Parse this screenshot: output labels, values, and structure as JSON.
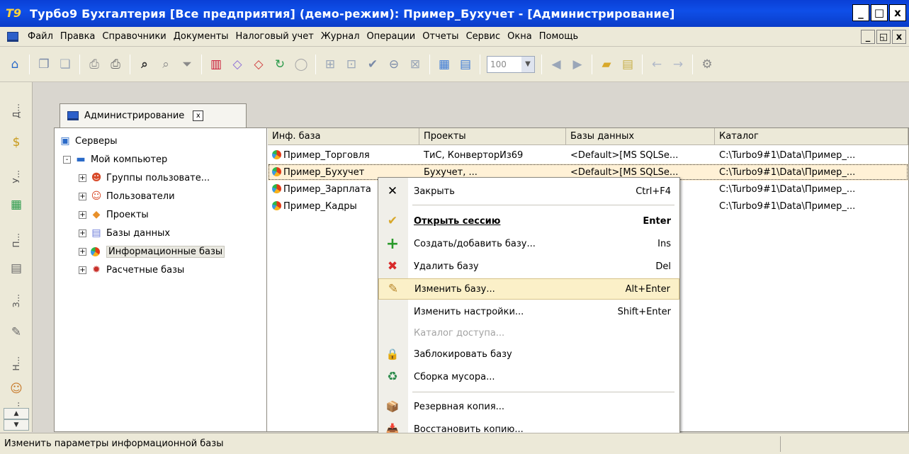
{
  "window": {
    "title": "Турбо9 Бухгалтерия [Все предприятия] (демо-режим): Пример_Бухучет - [Администрирование]",
    "app_icon": "Т9",
    "buttons": [
      "_",
      "□",
      "x"
    ]
  },
  "menubar": {
    "items": [
      "Файл",
      "Правка",
      "Справочники",
      "Документы",
      "Налоговый учет",
      "Журнал",
      "Операции",
      "Отчеты",
      "Сервис",
      "Окна",
      "Помощь"
    ],
    "mdi_buttons": [
      "_",
      "◱",
      "x"
    ]
  },
  "toolbar": {
    "zoom_value": "100",
    "icons": [
      "home-icon",
      "copy-icon",
      "paste-icon",
      "print-preview-icon",
      "print-icon",
      "search-icon",
      "find-next-icon",
      "filter-icon",
      "chart-icon",
      "eraser-icon",
      "pencil-icon",
      "refresh-icon",
      "stop-icon",
      "add-row-icon",
      "add-doc-icon",
      "check-icon",
      "minus-icon",
      "delete-icon",
      "calculator-icon",
      "calendar-icon",
      "back-icon",
      "forward-icon",
      "folder-icon",
      "notes-icon",
      "undo-icon",
      "redo-icon"
    ]
  },
  "sidebar": {
    "labels": [
      "Д...",
      "У...",
      "П...",
      "З...",
      "Н...",
      "О..."
    ]
  },
  "doc_tab": {
    "label": "Администрирование",
    "close": "x"
  },
  "tree": {
    "root": "Серверы",
    "computer": "Мой компьютер",
    "nodes": [
      "Группы пользовате...",
      "Пользователи",
      "Проекты",
      "Базы данных",
      "Информационные базы",
      "Расчетные базы"
    ],
    "expanders": [
      "+",
      "-"
    ]
  },
  "grid": {
    "columns": [
      "Инф. база",
      "Проекты",
      "Базы данных",
      "Каталог"
    ],
    "rows": [
      {
        "name": "Пример_Торговля",
        "projects": "ТиС, КонверторИз69",
        "db": "<Default>[MS SQLSe...",
        "catalog": "C:\\Turbo9#1\\Data\\Пример_..."
      },
      {
        "name": "Пример_Бухучет",
        "projects": "Бухучет, ...",
        "db": "<Default>[MS SQLSe...",
        "catalog": "C:\\Turbo9#1\\Data\\Пример_..."
      },
      {
        "name": "Пример_Зарплата",
        "projects": "",
        "db": "<Default>[MS SQLSe...",
        "catalog": "C:\\Turbo9#1\\Data\\Пример_..."
      },
      {
        "name": "Пример_Кадры",
        "projects": "",
        "db": "<Default>[MS SQLSe...",
        "catalog": "C:\\Turbo9#1\\Data\\Пример_..."
      }
    ]
  },
  "context_menu": {
    "items": [
      {
        "label": "Закрыть",
        "shortcut": "Ctrl+F4",
        "icon": "✕"
      },
      {
        "label": "Открыть сессию",
        "shortcut": "Enter",
        "icon": "✔"
      },
      {
        "label": "Создать/добавить базу...",
        "shortcut": "Ins",
        "icon": "+"
      },
      {
        "label": "Удалить базу",
        "shortcut": "Del",
        "icon": "✖"
      },
      {
        "label": "Изменить базу...",
        "shortcut": "Alt+Enter",
        "icon": "✎"
      },
      {
        "label": "Изменить настройки...",
        "shortcut": "Shift+Enter",
        "icon": ""
      },
      {
        "label": "Каталог доступа...",
        "shortcut": "",
        "icon": ""
      },
      {
        "label": "Заблокировать базу",
        "shortcut": "",
        "icon": "🔒"
      },
      {
        "label": "Сборка мусора...",
        "shortcut": "",
        "icon": "♻"
      },
      {
        "label": "Резервная копия...",
        "shortcut": "",
        "icon": "📦"
      },
      {
        "label": "Восстановить копию...",
        "shortcut": "",
        "icon": "📥"
      }
    ]
  },
  "statusbar": {
    "text": "Изменить параметры информационной базы"
  },
  "colors": {
    "titlebar": "#0f4fe8",
    "menu_highlight": "#fbf0c8",
    "selected_row": "#fff1d6",
    "chrome": "#ece9d8"
  }
}
